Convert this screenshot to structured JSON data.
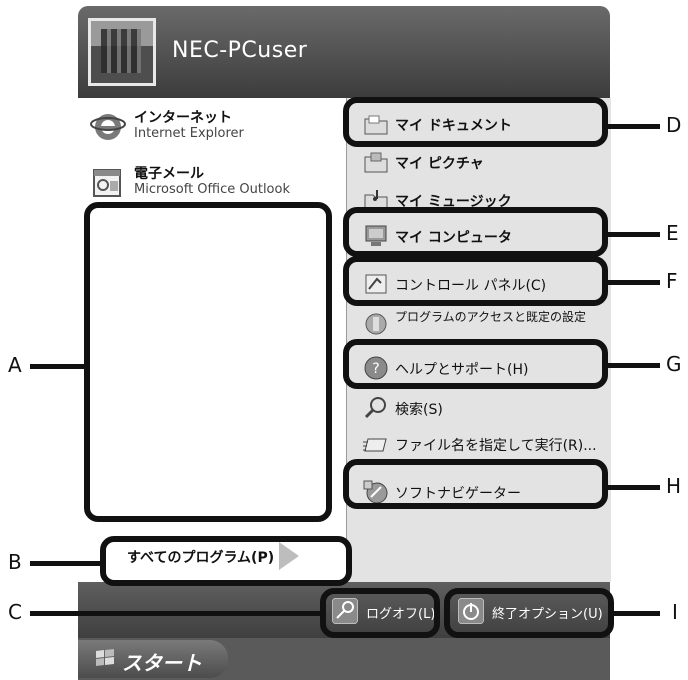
{
  "user": {
    "name": "NEC-PCuser"
  },
  "pinned": [
    {
      "title": "インターネット",
      "subtitle": "Internet Explorer",
      "icon": "internet-explorer-icon"
    },
    {
      "title": "電子メール",
      "subtitle": "Microsoft Office Outlook",
      "icon": "outlook-icon"
    }
  ],
  "all_programs": {
    "label": "すべてのプログラム(P)"
  },
  "right_items": [
    {
      "label": "マイ ドキュメント",
      "icon": "my-documents-icon"
    },
    {
      "label": "マイ ピクチャ",
      "icon": "my-pictures-icon"
    },
    {
      "label": "マイ ミュージック",
      "icon": "my-music-icon"
    },
    {
      "label": "マイ コンピュータ",
      "icon": "my-computer-icon"
    },
    {
      "label": "コントロール パネル(C)",
      "icon": "control-panel-icon"
    },
    {
      "label": "プログラムのアクセスと既定の設定",
      "icon": "program-access-icon"
    },
    {
      "label": "ヘルプとサポート(H)",
      "icon": "help-icon"
    },
    {
      "label": "検索(S)",
      "icon": "search-icon"
    },
    {
      "label": "ファイル名を指定して実行(R)...",
      "icon": "run-icon"
    },
    {
      "label": "ソフトナビゲーター",
      "icon": "soft-navigator-icon"
    }
  ],
  "footer": {
    "logoff": "ログオフ(L)",
    "shutdown": "終了オプション(U)"
  },
  "taskbar": {
    "start": "スタート"
  },
  "callouts": {
    "A": "A",
    "B": "B",
    "C": "C",
    "D": "D",
    "E": "E",
    "F": "F",
    "G": "G",
    "H": "H",
    "I": "I"
  }
}
